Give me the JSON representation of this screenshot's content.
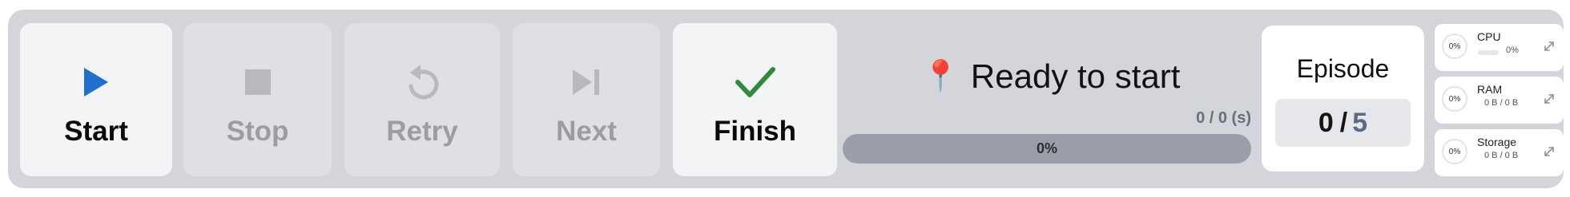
{
  "toolbar": {
    "start": {
      "label": "Start",
      "icon": "play-icon"
    },
    "stop": {
      "label": "Stop",
      "icon": "stop-icon"
    },
    "retry": {
      "label": "Retry",
      "icon": "retry-icon"
    },
    "next": {
      "label": "Next",
      "icon": "skip-next-icon"
    },
    "finish": {
      "label": "Finish",
      "icon": "check-icon"
    }
  },
  "status": {
    "pin_icon": "📍",
    "text": "Ready to start",
    "counter": "0 / 0 (s)",
    "progress_fraction": 0,
    "progress_text": "0%"
  },
  "episode": {
    "title": "Episode",
    "current": "0",
    "separator": "/",
    "total": "5"
  },
  "metrics": {
    "cpu": {
      "gauge": "0%",
      "name": "CPU",
      "value": "0%"
    },
    "ram": {
      "gauge": "0%",
      "name": "RAM",
      "value": "0 B / 0 B"
    },
    "storage": {
      "gauge": "0%",
      "name": "Storage",
      "value": "0 B / 0 B"
    }
  },
  "colors": {
    "accent_blue": "#1f6fd1",
    "success_green": "#2f8a3c",
    "disabled_icon": "#b7b9be",
    "panel_bg": "#d3d5db"
  }
}
